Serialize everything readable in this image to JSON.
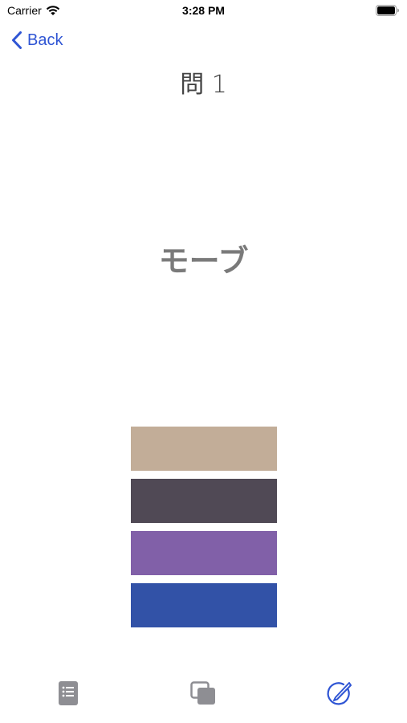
{
  "status_bar": {
    "carrier": "Carrier",
    "time": "3:28 PM",
    "icons": [
      "wifi-icon",
      "battery-icon"
    ]
  },
  "nav": {
    "back_label": "Back",
    "back_icon": "chevron-left-icon",
    "accent_color": "#2f55d4"
  },
  "question": {
    "title": "問 1",
    "color_word": "モーブ"
  },
  "swatches": [
    {
      "color": "#c2ad98"
    },
    {
      "color": "#504955"
    },
    {
      "color": "#8160a8"
    },
    {
      "color": "#3252a7"
    }
  ],
  "tab_bar": {
    "tabs": [
      {
        "icon": "list-document-icon",
        "color": "#8e8e93"
      },
      {
        "icon": "stacked-squares-icon",
        "color": "#8e8e93"
      },
      {
        "icon": "pen-circle-icon",
        "color": "#2f55d4"
      }
    ]
  }
}
